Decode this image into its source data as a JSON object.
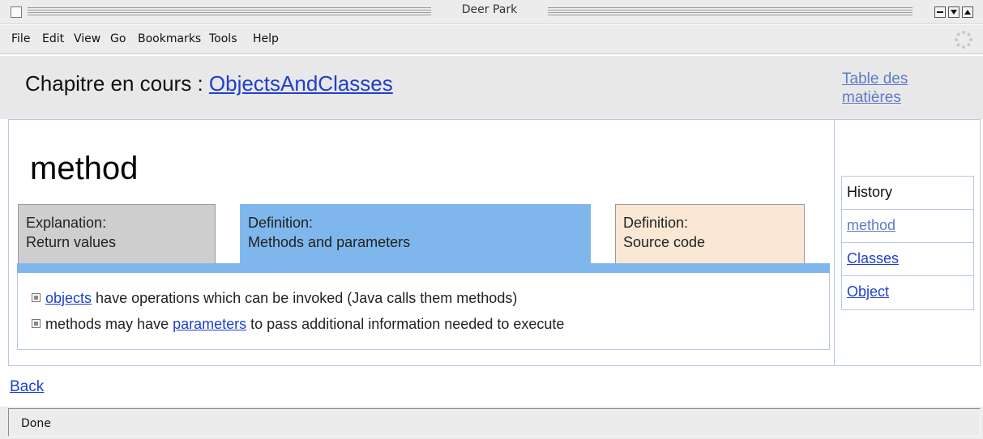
{
  "window": {
    "title": "Deer Park"
  },
  "menu": {
    "items": [
      {
        "label": "File"
      },
      {
        "label": "Edit"
      },
      {
        "label": "View"
      },
      {
        "label": "Go"
      },
      {
        "label": "Bookmarks"
      },
      {
        "label": "Tools"
      },
      {
        "label": "Help"
      }
    ]
  },
  "header": {
    "chapter_prefix": "Chapitre en cours : ",
    "chapter_link": "ObjectsAndClasses",
    "toc_link": "Table des matières"
  },
  "main": {
    "heading": "method",
    "tabs": [
      {
        "line1": "Explanation:",
        "line2": "Return values"
      },
      {
        "line1": "Definition:",
        "line2": "Methods and parameters"
      },
      {
        "line1": "Definition:",
        "line2": "Source code"
      }
    ],
    "definition": {
      "line1_link": "objects",
      "line1_text": " have operations which can be invoked (Java calls them methods)",
      "line2_before": "methods may have ",
      "line2_link": "parameters",
      "line2_after": " to pass additional information needed to execute"
    }
  },
  "sidebar": {
    "history_label": "History",
    "items": [
      {
        "label": "method"
      },
      {
        "label": "Classes"
      },
      {
        "label": "Object"
      }
    ]
  },
  "footer": {
    "back_link": "Back"
  },
  "status": {
    "text": "Done"
  },
  "colors": {
    "link": "#1f3fcc",
    "visited_link": "#5c7bc9",
    "active_tab": "#7fb7ec",
    "explanation_tab": "#cecece",
    "source_tab": "#fae8d4"
  }
}
